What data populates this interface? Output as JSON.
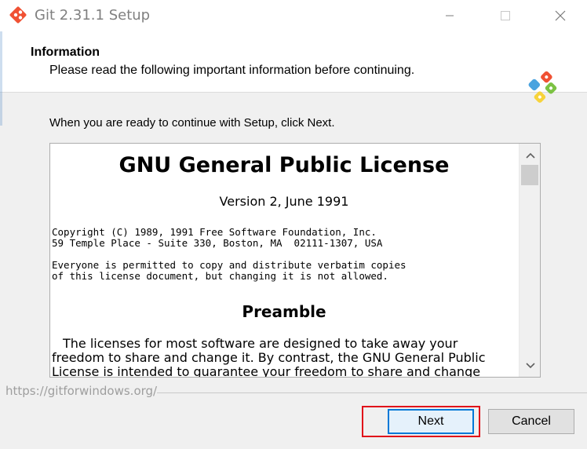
{
  "window": {
    "title": "Git 2.31.1 Setup"
  },
  "header": {
    "title": "Information",
    "subtitle": "Please read the following important information before continuing."
  },
  "intro_text": "When you are ready to continue with Setup, click Next.",
  "license": {
    "title": "GNU General Public License",
    "version": "Version 2, June 1991",
    "copyright_line1": "Copyright (C) 1989, 1991 Free Software Foundation, Inc.",
    "copyright_line2": "59 Temple Place - Suite 330, Boston, MA  02111-1307, USA",
    "permission_line1": "Everyone is permitted to copy and distribute verbatim copies",
    "permission_line2": "of this license document, but changing it is not allowed.",
    "preamble_heading": "Preamble",
    "preamble_text": "The licenses for most software are designed to take away your freedom to share and change it. By contrast, the GNU General Public License is intended to guarantee your freedom to share and change"
  },
  "footer": {
    "url": "https://gitforwindows.org/",
    "next_label": "Next",
    "cancel_label": "Cancel"
  },
  "icons": {
    "minimize": "minimize-icon",
    "maximize": "maximize-icon",
    "close": "close-icon",
    "scroll_up": "chevron-up-icon",
    "scroll_down": "chevron-down-icon"
  },
  "colors": {
    "highlight": "#e0101a",
    "default_button_border": "#0078d7"
  }
}
